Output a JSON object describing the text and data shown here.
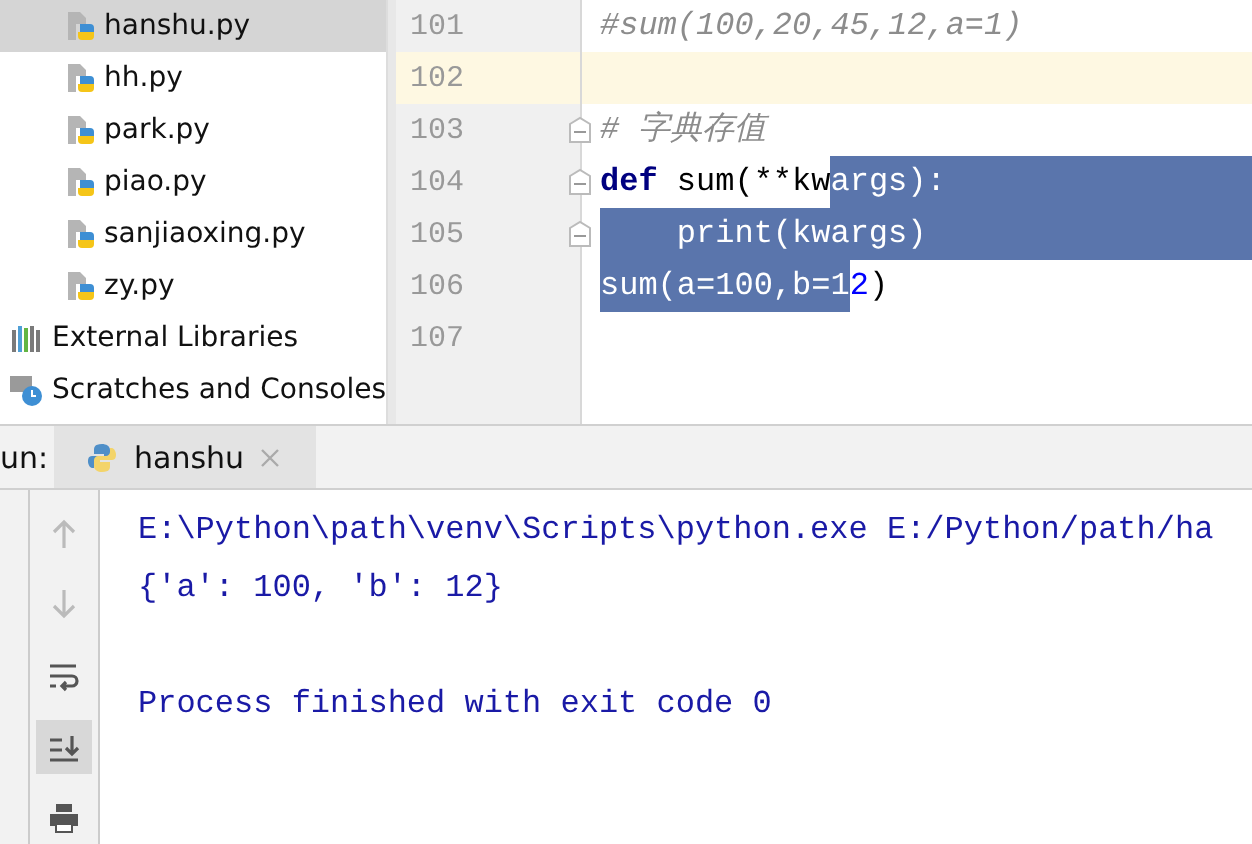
{
  "project_tree": {
    "items": [
      {
        "label": "hanshu.py",
        "kind": "python",
        "selected": true
      },
      {
        "label": "hh.py",
        "kind": "python",
        "selected": false
      },
      {
        "label": "park.py",
        "kind": "python",
        "selected": false
      },
      {
        "label": "piao.py",
        "kind": "python",
        "selected": false
      },
      {
        "label": "sanjiaoxing.py",
        "kind": "python",
        "selected": false
      },
      {
        "label": "zy.py",
        "kind": "python",
        "selected": false
      },
      {
        "label": "External Libraries",
        "kind": "libraries",
        "selected": false
      },
      {
        "label": "Scratches and Consoles",
        "kind": "scratches",
        "selected": false
      }
    ]
  },
  "editor": {
    "lines": [
      {
        "number": "101",
        "current": false,
        "fold": false,
        "selected_to_end": false,
        "segments": [
          {
            "text": "#sum(100,20,45,12,a=1)",
            "kind": "comment",
            "selected": false
          }
        ]
      },
      {
        "number": "102",
        "current": true,
        "fold": false,
        "selected_to_end": false
      },
      {
        "number": "103",
        "current": false,
        "fold": true,
        "selected_to_end": false,
        "segments": [
          {
            "text": "# 字典存值",
            "kind": "comment",
            "selected": false
          }
        ]
      },
      {
        "number": "104",
        "current": false,
        "fold": true,
        "selected_to_end": true,
        "segments": [
          {
            "text": "def",
            "kind": "keyword",
            "selected": false
          },
          {
            "text": " sum(**kw",
            "kind": "plain",
            "selected": false
          },
          {
            "text": "args):",
            "kind": "plain",
            "selected": true
          }
        ]
      },
      {
        "number": "105",
        "current": false,
        "fold": true,
        "selected_to_end": true,
        "segments": [
          {
            "text": "    print(kwargs)",
            "kind": "plain",
            "selected": true
          }
        ]
      },
      {
        "number": "106",
        "current": false,
        "fold": false,
        "selected_to_end": false,
        "segments": [
          {
            "text": "sum(a=100,b=1",
            "kind": "plain",
            "selected": true
          },
          {
            "text": "2",
            "kind": "number",
            "selected": false
          },
          {
            "text": ")",
            "kind": "plain",
            "selected": false
          }
        ]
      },
      {
        "number": "107",
        "current": false,
        "fold": false,
        "selected_to_end": false
      }
    ]
  },
  "run_panel": {
    "label": "un:",
    "tabs": [
      {
        "label": "hanshu",
        "selected": true
      }
    ],
    "toolbar": [
      {
        "kind": "up",
        "active": false
      },
      {
        "kind": "down",
        "active": false
      },
      {
        "kind": "wrap",
        "active": false
      },
      {
        "kind": "scroll-end",
        "active": true
      },
      {
        "kind": "print",
        "active": false
      }
    ],
    "console_lines": [
      "E:\\Python\\path\\venv\\Scripts\\python.exe E:/Python/path/ha",
      "{'a': 100, 'b': 12}",
      "Process finished with exit code 0"
    ]
  }
}
